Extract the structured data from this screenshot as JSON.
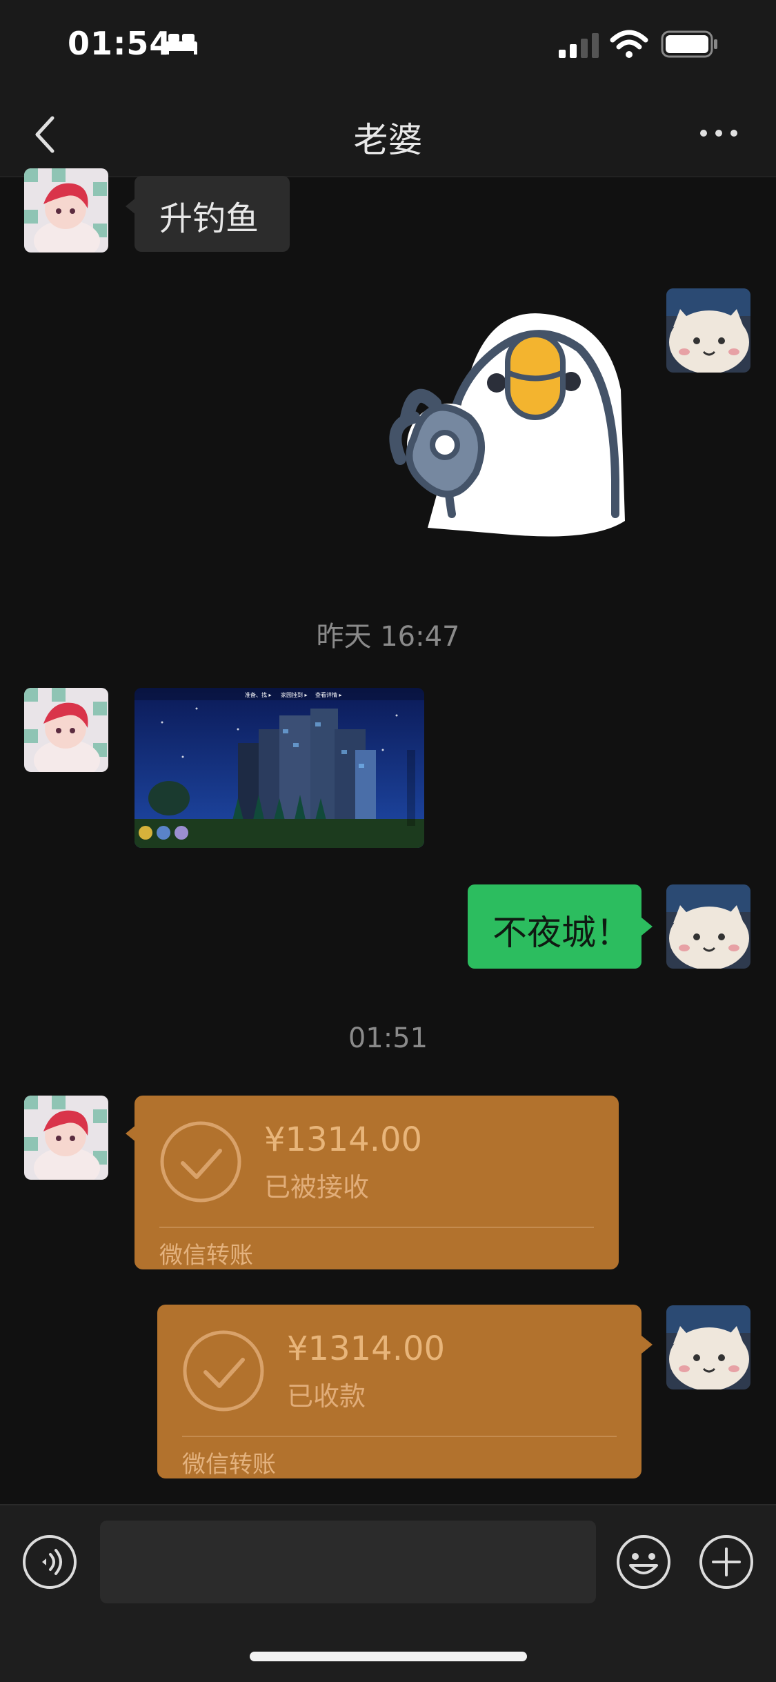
{
  "status_bar": {
    "time": "01:54"
  },
  "nav": {
    "title": "老婆"
  },
  "messages": {
    "m1": {
      "text": "升钓鱼"
    },
    "ts1": "昨天 16:47",
    "screenshot_overlay": {
      "top_labels": [
        "准备、找 ▸",
        "家园挂到 ▸",
        "查看详情 ▸"
      ]
    },
    "m3": {
      "text": "不夜城！"
    },
    "ts2": "01:51",
    "t1": {
      "amount": "¥1314.00",
      "status": "已被接收",
      "footer": "微信转账"
    },
    "t2": {
      "amount": "¥1314.00",
      "status": "已收款",
      "footer": "微信转账"
    }
  },
  "colors": {
    "background": "#111111",
    "bubble_self": "#2cbd5f",
    "bubble_other": "#2c2c2c",
    "transfer": "#b2722d"
  },
  "icons": [
    "back-icon",
    "more-icon",
    "sleep-icon",
    "signal-icon",
    "wifi-icon",
    "battery-icon",
    "voice-icon",
    "emoji-icon",
    "plus-icon",
    "check-icon"
  ]
}
